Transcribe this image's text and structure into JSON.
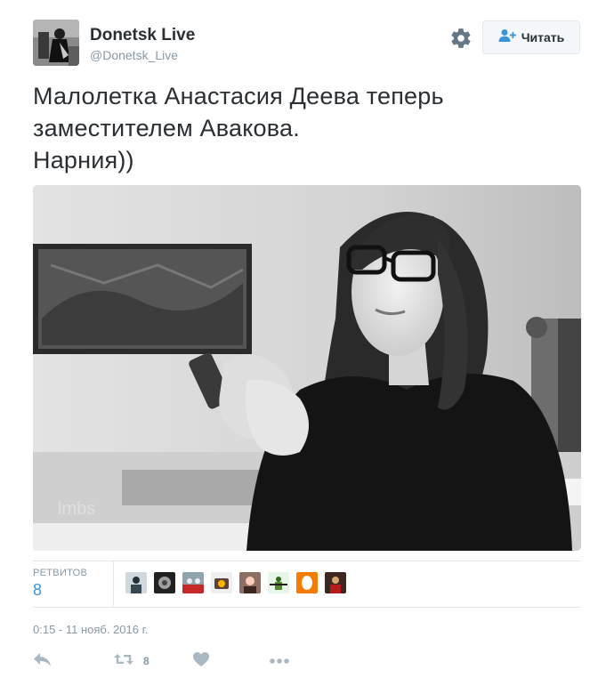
{
  "user": {
    "display_name": "Donetsk Live",
    "screen_name": "@Donetsk_Live",
    "avatar_icon": "profile-photo"
  },
  "header": {
    "settings_icon": "gear-icon",
    "follow_label": "Читать",
    "follow_icon": "person-add-icon"
  },
  "tweet": {
    "text": "Малолетка Анастасия Деева теперь\nзаместителем Авакова.\nНарния))",
    "media": {
      "kind": "photo",
      "watermark": "lmbs"
    }
  },
  "stats": {
    "retweets_label": "РЕТВИТОВ",
    "retweets_count": "8",
    "retweeter_avatars": 8
  },
  "timestamp": "0:15 - 11 нояб. 2016 г.",
  "actions": {
    "reply_icon": "reply-icon",
    "retweet_icon": "retweet-icon",
    "retweet_count": "8",
    "like_icon": "heart-icon",
    "more_icon": "more-icon"
  },
  "colors": {
    "text": "#292f33",
    "muted": "#8899a6",
    "link": "#3b94d9",
    "border": "#e1e8ed",
    "follow_icon": "#3b94d9"
  }
}
